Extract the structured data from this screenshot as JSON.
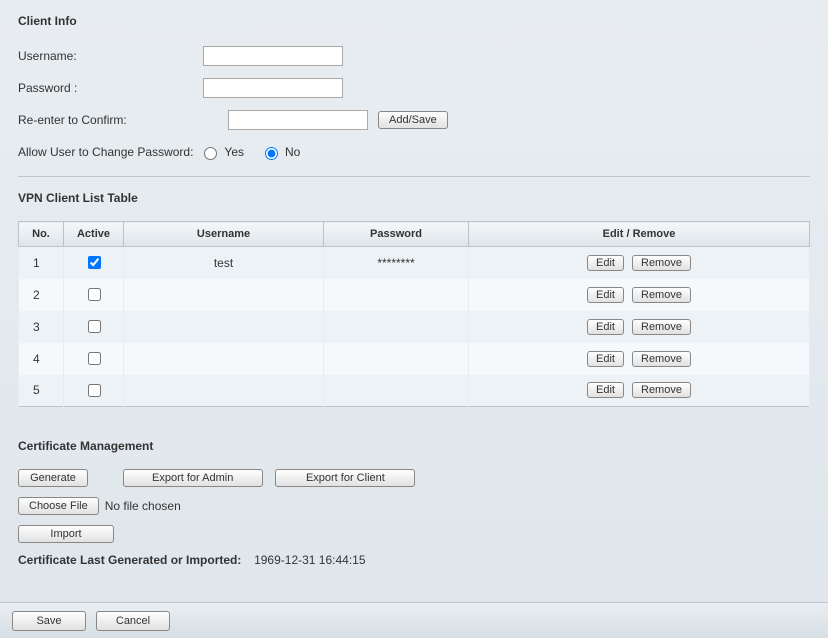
{
  "clientInfo": {
    "title": "Client Info",
    "usernameLabel": "Username:",
    "usernameValue": "",
    "passwordLabel": "Password :",
    "passwordValue": "",
    "confirmLabel": "Re-enter to Confirm:",
    "confirmValue": "",
    "addSave": "Add/Save",
    "allowChangeLabel": "Allow User to Change Password:",
    "yesLabel": "Yes",
    "noLabel": "No",
    "allowChangeSelected": "no"
  },
  "vpnTable": {
    "title": "VPN Client List Table",
    "headers": {
      "no": "No.",
      "active": "Active",
      "username": "Username",
      "password": "Password",
      "editRemove": "Edit / Remove"
    },
    "editLabel": "Edit",
    "removeLabel": "Remove",
    "rows": [
      {
        "no": "1",
        "active": true,
        "username": "test",
        "password": "********"
      },
      {
        "no": "2",
        "active": false,
        "username": "",
        "password": ""
      },
      {
        "no": "3",
        "active": false,
        "username": "",
        "password": ""
      },
      {
        "no": "4",
        "active": false,
        "username": "",
        "password": ""
      },
      {
        "no": "5",
        "active": false,
        "username": "",
        "password": ""
      }
    ]
  },
  "cert": {
    "title": "Certificate Management",
    "generate": "Generate",
    "exportAdmin": "Export for Admin",
    "exportClient": "Export for Client",
    "chooseFile": "Choose File",
    "noFile": "No file chosen",
    "import": "Import",
    "lastLabel": "Certificate Last Generated or Imported:",
    "lastValue": "1969-12-31 16:44:15"
  },
  "footer": {
    "save": "Save",
    "cancel": "Cancel"
  }
}
